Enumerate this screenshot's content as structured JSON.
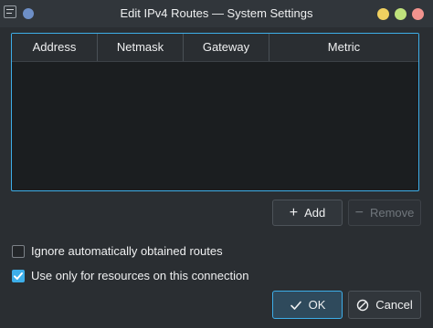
{
  "window": {
    "title": "Edit IPv4 Routes — System Settings"
  },
  "table": {
    "columns": [
      "Address",
      "Netmask",
      "Gateway",
      "Metric"
    ],
    "rows": []
  },
  "buttons": {
    "add_label": "Add",
    "remove_label": "Remove",
    "ok_label": "OK",
    "cancel_label": "Cancel"
  },
  "options": {
    "ignore_routes": {
      "label": "Ignore automatically obtained routes",
      "checked": false
    },
    "use_only_resources": {
      "label": "Use only for resources on this connection",
      "checked": true
    }
  },
  "colors": {
    "accent": "#3daee9",
    "window_bg": "#2a2e32",
    "table_bg": "#1b1e20"
  }
}
